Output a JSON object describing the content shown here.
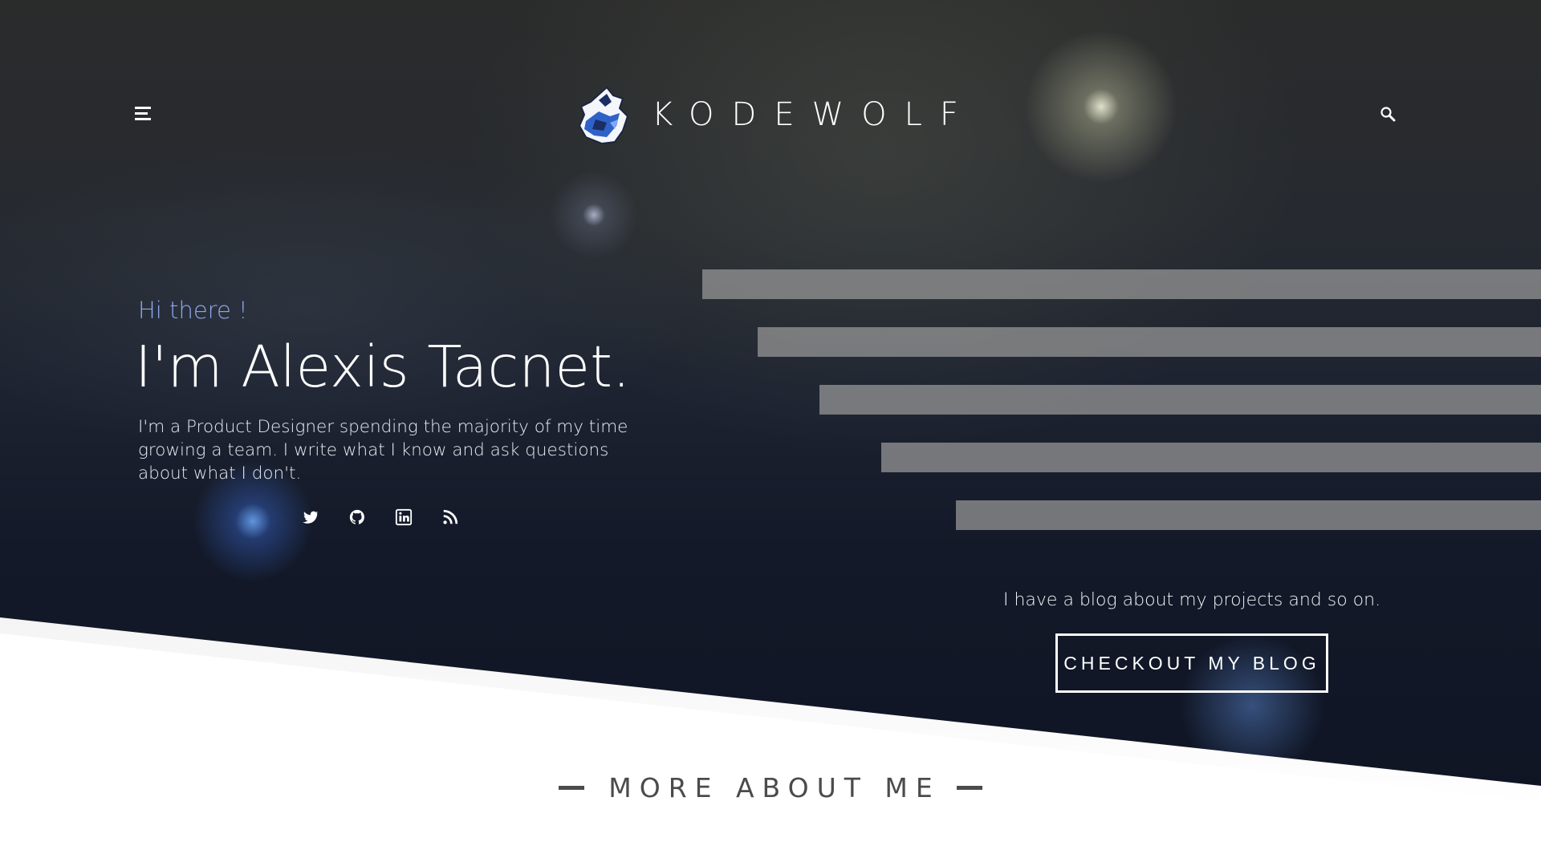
{
  "header": {
    "brand": "KODEWOLF",
    "menu_icon": "hamburger-menu-icon",
    "search_icon": "search-icon",
    "logo_icon": "wolf-head-icon"
  },
  "intro": {
    "greeting": "Hi there !",
    "name": "I'm Alexis Tacnet.",
    "bio": "I'm a Product Designer spending the majority of my time growing a team. I write what I know and ask questions about what I don't.",
    "socials": [
      {
        "icon": "twitter-icon"
      },
      {
        "icon": "github-icon"
      },
      {
        "icon": "linkedin-icon"
      },
      {
        "icon": "rss-icon"
      }
    ]
  },
  "blog": {
    "text": "I have a blog about my projects and so on.",
    "button": "CHECKOUT MY BLOG"
  },
  "more_section": {
    "title": "MORE ABOUT ME"
  },
  "colors": {
    "accent": "#8ea6f0",
    "bars": "#969696",
    "section_text": "#4b4b4b"
  }
}
